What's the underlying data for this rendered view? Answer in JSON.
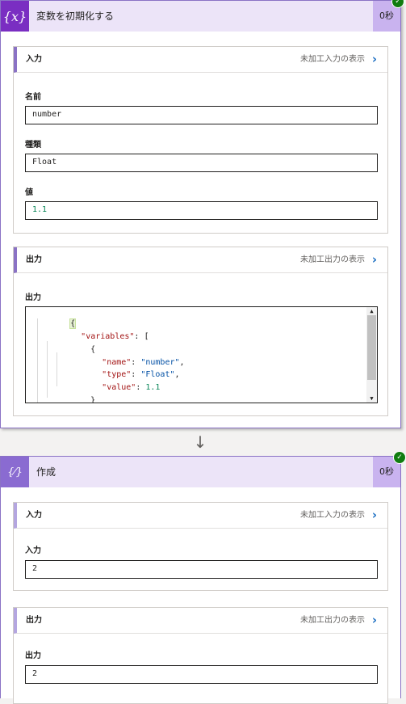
{
  "steps": [
    {
      "title": "変数を初期化する",
      "duration": "0秒",
      "icon": "variable-icon",
      "icon_glyph": "{x}",
      "input_section": {
        "title": "入力",
        "raw_link": "未加工入力の表示",
        "fields": [
          {
            "label": "名前",
            "value": "number"
          },
          {
            "label": "種類",
            "value": "Float"
          },
          {
            "label": "値",
            "value": "1.1"
          }
        ]
      },
      "output_section": {
        "title": "出力",
        "raw_link": "未加工出力の表示",
        "field_label": "出力",
        "code": {
          "open": "{",
          "variables_key": "\"variables\"",
          "array_open": "[",
          "obj_open": "{",
          "name_key": "\"name\"",
          "name_val": "\"number\"",
          "type_key": "\"type\"",
          "type_val": "\"Float\"",
          "value_key": "\"value\"",
          "value_val": "1.1",
          "obj_close": "}",
          "array_close": "]"
        }
      }
    },
    {
      "title": "作成",
      "duration": "0秒",
      "icon": "compose-icon",
      "icon_glyph": "{⁄}",
      "input_section": {
        "title": "入力",
        "raw_link": "未加工入力の表示",
        "field_label": "入力",
        "value": "2"
      },
      "output_section": {
        "title": "出力",
        "raw_link": "未加工出力の表示",
        "field_label": "出力",
        "value": "2"
      }
    }
  ],
  "colors": {
    "accent": "#7a2ec2",
    "header_bg": "#ece4f8",
    "success": "#107c10",
    "link": "#1b6ec2"
  },
  "icons": {
    "status": "success-check-icon",
    "chevron": "chevron-right-icon",
    "connector": "down-arrow-icon"
  }
}
